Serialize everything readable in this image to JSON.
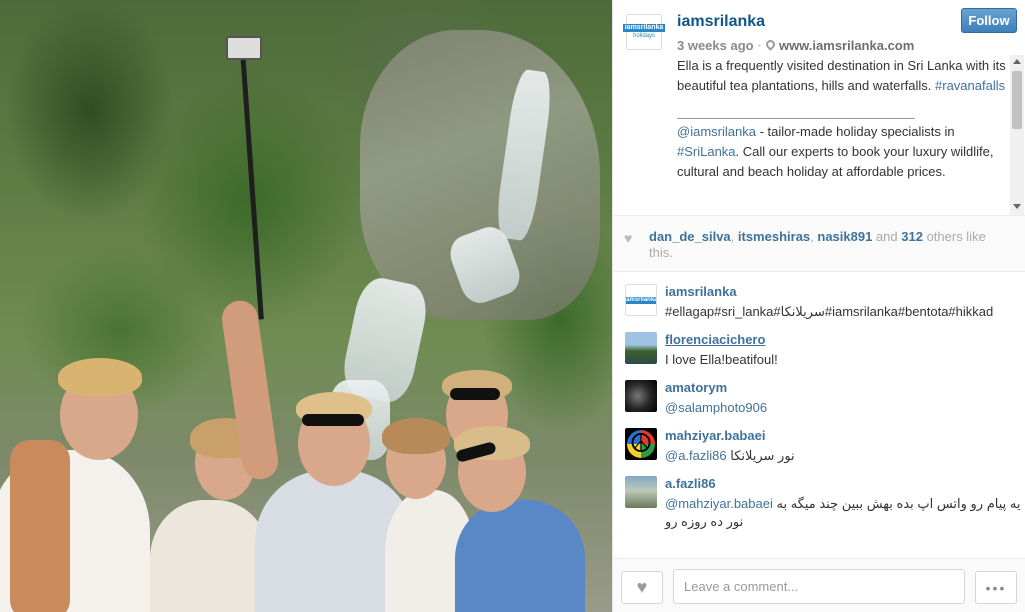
{
  "post": {
    "username": "iamsrilanka",
    "follow_label": "Follow",
    "time_ago": "3 weeks ago",
    "location": "www.iamsrilanka.com",
    "logo_text_top": "iamsrilanka",
    "logo_text_bottom": "holidays",
    "caption": {
      "line1": "Ella is a frequently visited destination in Sri Lanka with its beautiful tea plantations, hills and waterfalls.",
      "hashtag1": "#ravanafalls",
      "mention": "@iamsrilanka",
      "line2_after_mention": " - tailor-made holiday specialists in ",
      "hashtag2": "#SriLanka",
      "line3": ". Call our experts to book your luxury wildlife, cultural and beach holiday at affordable prices."
    }
  },
  "likes": {
    "user1": "dan_de_silva",
    "sep1": ", ",
    "user2": "itsmeshiras",
    "sep2": ", ",
    "user3": "nasik891",
    "and_text": " and ",
    "count": "312",
    "suffix": " others like this."
  },
  "comments": [
    {
      "user": "iamsrilanka",
      "text": "#ellagap#sri_lanka#سریلانکا#iamsrilanka#bentota#hikkad"
    },
    {
      "user": "florenciacichero",
      "text": "I love Ella!beatifoul!"
    },
    {
      "user": "amatorym",
      "text": "@salamphoto906"
    },
    {
      "user": "mahziyar.babaei",
      "mention": "@a.fazli86",
      "text": "نور سریلانکا"
    },
    {
      "user": "a.fazli86",
      "mention": "@mahziyar.babaei",
      "text": "یه پیام رو واتس اپ بده بهش ببین چند میگه به",
      "text2": "نور ده روزه رو"
    }
  ],
  "footer": {
    "comment_placeholder": "Leave a comment...",
    "more_label": "•••"
  },
  "colors": {
    "link": "#3f729b",
    "username": "#125688",
    "follow_button": "#3f7fb8"
  },
  "icons": {
    "heart": "heart-icon",
    "pin": "location-pin-icon",
    "more": "ellipsis-icon"
  }
}
